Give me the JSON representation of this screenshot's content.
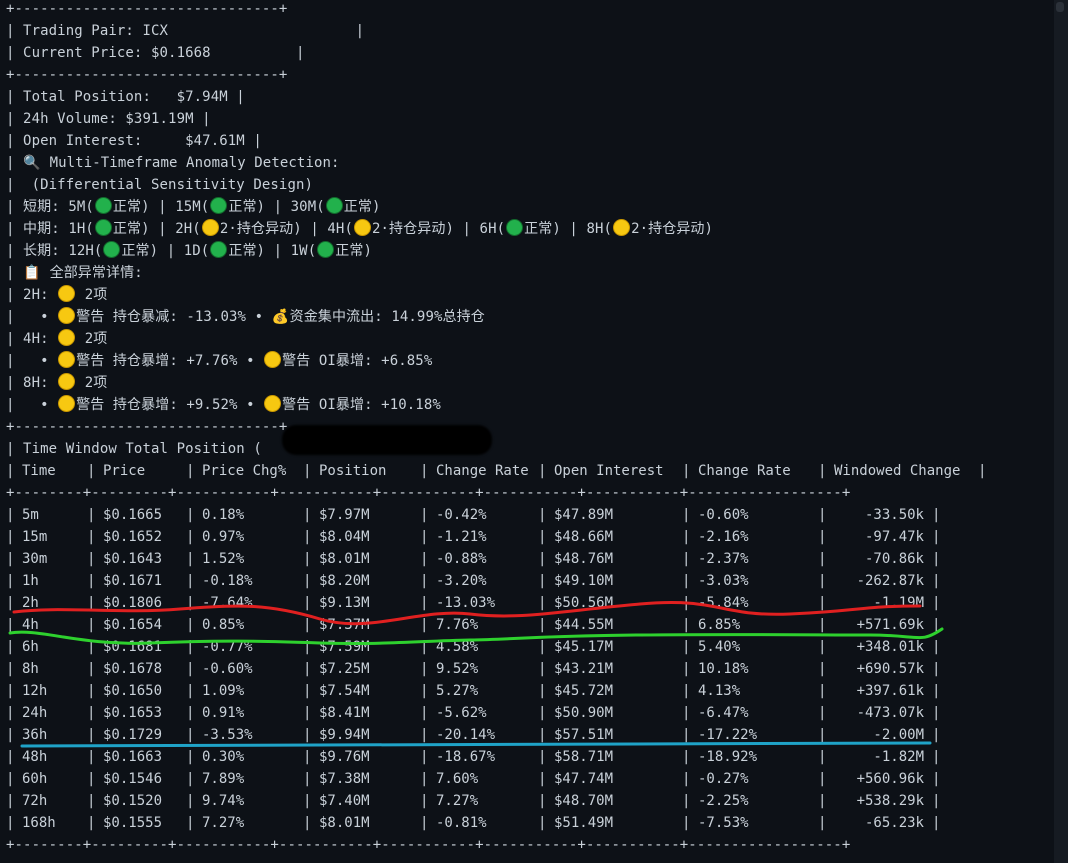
{
  "border_short": "+-------------------------------+",
  "header": {
    "pair_line": "| Trading Pair: ICX                      |",
    "price_line": "| Current Price: $0.1668          |"
  },
  "summary": {
    "position_line": "| Total Position:   $7.94M |",
    "volume_line": "| 24h Volume: $391.19M |",
    "oi_line": "| Open Interest:     $47.61M |"
  },
  "anomaly": {
    "title_line_prefix": "| ",
    "title_icon": "magnifier-icon",
    "title_text": " Multi-Timeframe Anomaly Detection:",
    "subtitle_line": "|  (Differential Sensitivity Design)",
    "short": {
      "label": "| 短期: 5M(",
      "items": [
        "正常) | 15M(",
        "正常) | 30M(",
        "正常)"
      ]
    },
    "mid_text_a": "| 中期: 1H(",
    "mid_text_b": "正常) | 2H(",
    "mid_text_c": "2·持仓异动) | 4H(",
    "mid_text_d": "2·持仓异动) | 6H(",
    "mid_text_e": "正常) | 8H(",
    "mid_text_f": "2·持仓异动)",
    "long_text_a": "| 长期: 12H(",
    "long_text_b": "正常) | 1D(",
    "long_text_c": "正常) | 1W(",
    "long_text_d": "正常)",
    "details_title_prefix": "| ",
    "details_icon": "clipboard-icon",
    "details_title": " 全部异常详情:",
    "h2_label": "| 2H: ",
    "h2_count": " 2项",
    "h2_detail_a": "|   • ",
    "h2_detail_b": "警告 持仓暴减: -13.03% • ",
    "h2_detail_icon": "money-bag-icon",
    "h2_detail_c": "资金集中流出: 14.99%总持仓",
    "h4_label": "| 4H: ",
    "h4_count": " 2项",
    "h4_detail_a": "|   • ",
    "h4_detail_b": "警告 持仓暴增: +7.76% • ",
    "h4_detail_c": "警告 OI暴增: +6.85%",
    "h8_label": "| 8H: ",
    "h8_count": " 2项",
    "h8_detail_a": "|   • ",
    "h8_detail_b": "警告 持仓暴增: +9.52% • ",
    "h8_detail_c": "警告 OI暴增: +10.18%"
  },
  "table": {
    "title_line": "| Time Window Total Position (",
    "divider_line": "+--------+---------+-----------+-----------+-----------+-----------+-----------+------------------+",
    "columns": [
      "Time",
      "Price",
      "Price Chg%",
      "Position",
      "Change Rate",
      "Open Interest",
      "Change Rate",
      "Windowed Change"
    ],
    "rows": [
      [
        "5m",
        "$0.1665",
        "0.18%",
        "$7.97M",
        "-0.42%",
        "$47.89M",
        "-0.60%",
        "-33.50k"
      ],
      [
        "15m",
        "$0.1652",
        "0.97%",
        "$8.04M",
        "-1.21%",
        "$48.66M",
        "-2.16%",
        "-97.47k"
      ],
      [
        "30m",
        "$0.1643",
        "1.52%",
        "$8.01M",
        "-0.88%",
        "$48.76M",
        "-2.37%",
        "-70.86k"
      ],
      [
        "1h",
        "$0.1671",
        "-0.18%",
        "$8.20M",
        "-3.20%",
        "$49.10M",
        "-3.03%",
        "-262.87k"
      ],
      [
        "2h",
        "$0.1806",
        "-7.64%",
        "$9.13M",
        "-13.03%",
        "$50.56M",
        "-5.84%",
        "-1.19M"
      ],
      [
        "4h",
        "$0.1654",
        "0.85%",
        "$7.37M",
        "7.76%",
        "$44.55M",
        "6.85%",
        "+571.69k"
      ],
      [
        "6h",
        "$0.1681",
        "-0.77%",
        "$7.59M",
        "4.58%",
        "$45.17M",
        "5.40%",
        "+348.01k"
      ],
      [
        "8h",
        "$0.1678",
        "-0.60%",
        "$7.25M",
        "9.52%",
        "$43.21M",
        "10.18%",
        "+690.57k"
      ],
      [
        "12h",
        "$0.1650",
        "1.09%",
        "$7.54M",
        "5.27%",
        "$45.72M",
        "4.13%",
        "+397.61k"
      ],
      [
        "24h",
        "$0.1653",
        "0.91%",
        "$8.41M",
        "-5.62%",
        "$50.90M",
        "-6.47%",
        "-473.07k"
      ],
      [
        "36h",
        "$0.1729",
        "-3.53%",
        "$9.94M",
        "-20.14%",
        "$57.51M",
        "-17.22%",
        "-2.00M"
      ],
      [
        "48h",
        "$0.1663",
        "0.30%",
        "$9.76M",
        "-18.67%",
        "$58.71M",
        "-18.92%",
        "-1.82M"
      ],
      [
        "60h",
        "$0.1546",
        "7.89%",
        "$7.38M",
        "7.60%",
        "$47.74M",
        "-0.27%",
        "+560.96k"
      ],
      [
        "72h",
        "$0.1520",
        "9.74%",
        "$7.40M",
        "7.27%",
        "$48.70M",
        "-2.25%",
        "+538.29k"
      ],
      [
        "168h",
        "$0.1555",
        "7.27%",
        "$8.01M",
        "-0.81%",
        "$51.49M",
        "-7.53%",
        "-65.23k"
      ]
    ]
  },
  "colors": {
    "background": "#0d1117",
    "text": "#c9d1d9",
    "border": "#58a6ff",
    "red_mark": "#e02020",
    "green_mark": "#2ed12e",
    "blue_mark": "#1fa3c8"
  }
}
